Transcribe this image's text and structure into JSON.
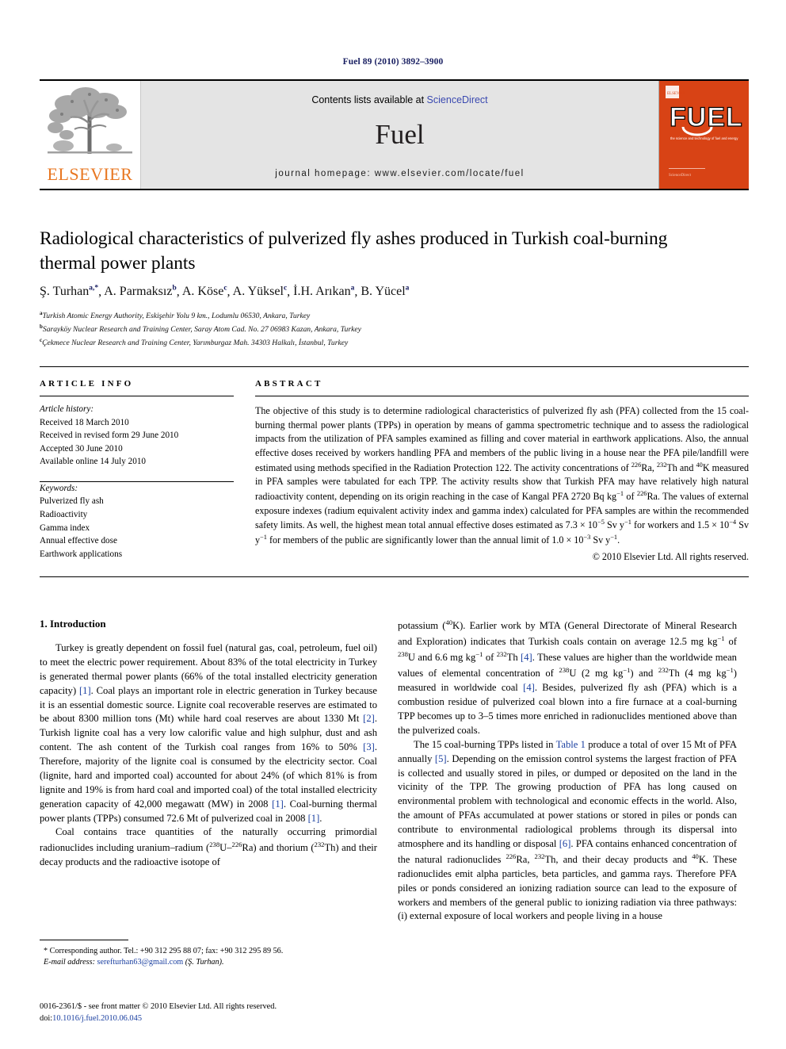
{
  "running_head": "Fuel 89 (2010) 3892–3900",
  "masthead": {
    "contents_prefix": "Contents lists available at ",
    "sciencedirect": "ScienceDirect",
    "journal_name": "Fuel",
    "homepage": "journal homepage: www.elsevier.com/locate/fuel",
    "publisher_wordmark": "ELSEVIER",
    "publisher_logo_color": "#e87722",
    "cover_title": "FUEL",
    "cover_subtitle": "the science and technology of fuel and energy",
    "cover_color": "#d84315"
  },
  "article": {
    "title": "Radiological characteristics of pulverized fly ashes produced in Turkish coal-burning thermal power plants",
    "authors": [
      {
        "name": "Ş. Turhan",
        "marks": "a,*"
      },
      {
        "name": "A. Parmaksız",
        "marks": "b"
      },
      {
        "name": "A. Köse",
        "marks": "c"
      },
      {
        "name": "A. Yüksel",
        "marks": "c"
      },
      {
        "name": "İ.H. Arıkan",
        "marks": "a"
      },
      {
        "name": "B. Yücel",
        "marks": "a"
      }
    ],
    "affiliations": [
      {
        "mark": "a",
        "text": "Turkish Atomic Energy Authority, Eskişehir Yolu 9 km., Lodumlu 06530, Ankara, Turkey"
      },
      {
        "mark": "b",
        "text": "Sarayköy Nuclear Research and Training Center, Saray Atom Cad. No. 27 06983 Kazan, Ankara, Turkey"
      },
      {
        "mark": "c",
        "text": "Çekmece Nuclear Research and Training Center, Yarımburgaz Mah. 34303 Halkalı, İstanbul, Turkey"
      }
    ]
  },
  "article_info": {
    "heading": "ARTICLE INFO",
    "history_label": "Article history:",
    "history": [
      "Received 18 March 2010",
      "Received in revised form 29 June 2010",
      "Accepted 30 June 2010",
      "Available online 14 July 2010"
    ],
    "keywords_label": "Keywords:",
    "keywords": [
      "Pulverized fly ash",
      "Radioactivity",
      "Gamma index",
      "Annual effective dose",
      "Earthwork applications"
    ]
  },
  "abstract": {
    "heading": "ABSTRACT",
    "paragraphs": [
      "The objective of this study is to determine radiological characteristics of pulverized fly ash (PFA) collected from the 15 coal-burning thermal power plants (TPPs) in operation by means of gamma spectrometric technique and to assess the radiological impacts from the utilization of PFA samples examined as filling and cover material in earthwork applications. Also, the annual effective doses received by workers handling PFA and members of the public living in a house near the PFA pile/landfill were estimated using methods specified in the Radiation Protection 122. The activity concentrations of <sup>226</sup>Ra, <sup>232</sup>Th and <sup>40</sup>K measured in PFA samples were tabulated for each TPP. The activity results show that Turkish PFA may have relatively high natural radioactivity content, depending on its origin reaching in the case of Kangal PFA 2720 Bq kg<sup>−1</sup> of <sup>226</sup>Ra. The values of external exposure indexes (radium equivalent activity index and gamma index) calculated for PFA samples are within the recommended safety limits. As well, the highest mean total annual effective doses estimated as 7.3 × 10<sup>−5</sup> Sv y<sup>−1</sup> for workers and 1.5 × 10<sup>−4</sup> Sv y<sup>−1</sup> for members of the public are significantly lower than the annual limit of 1.0 × 10<sup>−3</sup> Sv y<sup>−1</sup>."
    ],
    "copyright": "© 2010 Elsevier Ltd. All rights reserved."
  },
  "body": {
    "section_heading": "1. Introduction",
    "left_paragraphs": [
      "Turkey is greatly dependent on fossil fuel (natural gas, coal, petroleum, fuel oil) to meet the electric power requirement. About 83% of the total electricity in Turkey is generated thermal power plants (66% of the total installed electricity generation capacity) <span class=\"ref\">[1]</span>. Coal plays an important role in electric generation in Turkey because it is an essential domestic source. Lignite coal recoverable reserves are estimated to be about 8300 million tons (Mt) while hard coal reserves are about 1330 Mt <span class=\"ref\">[2]</span>. Turkish lignite coal has a very low calorific value and high sulphur, dust and ash content. The ash content of the Turkish coal ranges from 16% to 50% <span class=\"ref\">[3]</span>. Therefore, majority of the lignite coal is consumed by the electricity sector. Coal (lignite, hard and imported coal) accounted for about 24% (of which 81% is from lignite and 19% is from hard coal and imported coal) of the total installed electricity generation capacity of 42,000 megawatt (MW) in 2008 <span class=\"ref\">[1]</span>. Coal-burning thermal power plants (TPPs) consumed 72.6 Mt of pulverized coal in 2008 <span class=\"ref\">[1]</span>.",
      "Coal contains trace quantities of the naturally occurring primordial radionuclides including uranium–radium (<sup>238</sup>U–<sup>226</sup>Ra) and thorium (<sup>232</sup>Th) and their decay products and the radioactive isotope of"
    ],
    "right_paragraphs": [
      "potassium (<sup>40</sup>K). Earlier work by MTA (General Directorate of Mineral Research and Exploration) indicates that Turkish coals contain on average 12.5 mg kg<sup>−1</sup> of <sup>238</sup>U and 6.6 mg kg<sup>−1</sup> of <sup>232</sup>Th <span class=\"ref\">[4]</span>. These values are higher than the worldwide mean values of elemental concentration of <sup>238</sup>U (2 mg kg<sup>−1</sup>) and <sup>232</sup>Th (4 mg kg<sup>−1</sup>) measured in worldwide coal <span class=\"ref\">[4]</span>. Besides, pulverized fly ash (PFA) which is a combustion residue of pulverized coal blown into a fire furnace at a coal-burning TPP becomes up to 3–5 times more enriched in radionuclides mentioned above than the pulverized coals.",
      "The 15 coal-burning TPPs listed in <span class=\"ref\">Table 1</span> produce a total of over 15 Mt of PFA annually <span class=\"ref\">[5]</span>. Depending on the emission control systems the largest fraction of PFA is collected and usually stored in piles, or dumped or deposited on the land in the vicinity of the TPP. The growing production of PFA has long caused on environmental problem with technological and economic effects in the world. Also, the amount of PFAs accumulated at power stations or stored in piles or ponds can contribute to environmental radiological problems through its dispersal into atmosphere and its handling or disposal <span class=\"ref\">[6]</span>. PFA contains enhanced concentration of the natural radionuclides <sup>226</sup>Ra, <sup>232</sup>Th, and their decay products and <sup>40</sup>K. These radionuclides emit alpha particles, beta particles, and gamma rays. Therefore PFA piles or ponds considered an ionizing radiation source can lead to the exposure of workers and members of the general public to ionizing radiation via three pathways: (i) external exposure of local workers and people living in a house"
    ]
  },
  "footnote": {
    "corresponding": "* Corresponding author. Tel.: +90 312 295 88 07; fax: +90 312 295 89 56.",
    "email_label": "E-mail address:",
    "email": "serefturhan63@gmail.com",
    "email_owner": "(Ş. Turhan)."
  },
  "imprint": {
    "line1": "0016-2361/$ - see front matter © 2010 Elsevier Ltd. All rights reserved.",
    "doi_label": "doi:",
    "doi": "10.1016/j.fuel.2010.06.045"
  }
}
